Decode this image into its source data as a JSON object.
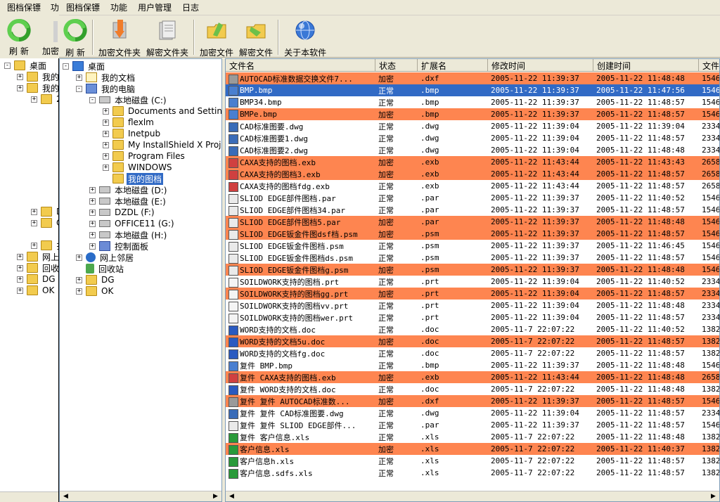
{
  "back_window": {
    "menu": [
      "图档保镖",
      "功"
    ],
    "toolbar": [
      "刷 新",
      "加密"
    ]
  },
  "menu": [
    "图档保镖",
    "功能",
    "用户管理",
    "日志"
  ],
  "toolbar": [
    {
      "label": "刷 新",
      "icon": "refresh-icon"
    },
    {
      "label": "加密文件夹",
      "icon": "encrypt-folder-icon"
    },
    {
      "label": "解密文件夹",
      "icon": "decrypt-folder-icon"
    },
    {
      "label": "加密文件",
      "icon": "encrypt-file-icon"
    },
    {
      "label": "解密文件",
      "icon": "decrypt-file-icon"
    },
    {
      "label": "关于本软件",
      "icon": "about-icon"
    }
  ],
  "back_tree": [
    {
      "label": "桌面"
    },
    {
      "label": "我的"
    },
    {
      "label": "我的"
    },
    {
      "label": "2"
    },
    {
      "label": "D"
    },
    {
      "label": "O"
    },
    {
      "label": "扌"
    },
    {
      "label": "网上"
    },
    {
      "label": "回收"
    },
    {
      "label": "DG"
    },
    {
      "label": "OK"
    }
  ],
  "tree": [
    {
      "label": "桌面",
      "icon": "desk",
      "level": 0,
      "exp": "-"
    },
    {
      "label": "我的文档",
      "icon": "docs",
      "level": 1,
      "exp": "+"
    },
    {
      "label": "我的电脑",
      "icon": "comp",
      "level": 1,
      "exp": "-"
    },
    {
      "label": "本地磁盘 (C:)",
      "icon": "drive",
      "level": 2,
      "exp": "-"
    },
    {
      "label": "Documents and Settings",
      "icon": "folder",
      "level": 3,
      "exp": "+"
    },
    {
      "label": "flexlm",
      "icon": "folder",
      "level": 3,
      "exp": "+"
    },
    {
      "label": "Inetpub",
      "icon": "folder",
      "level": 3,
      "exp": "+"
    },
    {
      "label": "My InstallShield X Projects",
      "icon": "folder",
      "level": 3,
      "exp": "+"
    },
    {
      "label": "Program Files",
      "icon": "folder",
      "level": 3,
      "exp": "+"
    },
    {
      "label": "WINDOWS",
      "icon": "folder",
      "level": 3,
      "exp": "+"
    },
    {
      "label": "我的图档",
      "icon": "folder",
      "level": 3,
      "exp": "",
      "selected": true
    },
    {
      "label": "本地磁盘 (D:)",
      "icon": "drive",
      "level": 2,
      "exp": "+"
    },
    {
      "label": "本地磁盘 (E:)",
      "icon": "drive",
      "level": 2,
      "exp": "+"
    },
    {
      "label": "DZDL (F:)",
      "icon": "drive",
      "level": 2,
      "exp": "+"
    },
    {
      "label": "OFFICE11 (G:)",
      "icon": "drive",
      "level": 2,
      "exp": "+"
    },
    {
      "label": "本地磁盘 (H:)",
      "icon": "drive",
      "level": 2,
      "exp": "+"
    },
    {
      "label": "控制面板",
      "icon": "panel",
      "level": 2,
      "exp": "+"
    },
    {
      "label": "网上邻居",
      "icon": "net",
      "level": 1,
      "exp": "+"
    },
    {
      "label": "回收站",
      "icon": "recycle",
      "level": 1,
      "exp": ""
    },
    {
      "label": "DG",
      "icon": "folder",
      "level": 1,
      "exp": "+"
    },
    {
      "label": "OK",
      "icon": "folder",
      "level": 1,
      "exp": "+"
    }
  ],
  "columns": [
    "文件名",
    "状态",
    "扩展名",
    "修改时间",
    "创建时间",
    "文件"
  ],
  "files": [
    {
      "name": "AUTOCAD标准数据交换文件7...",
      "status": "加密",
      "ext": ".dxf",
      "mtime": "2005-11-22 11:39:37",
      "ctime": "2005-11-22 11:48:48",
      "size": "1546",
      "state": "enc"
    },
    {
      "name": "BMP.bmp",
      "status": "正常",
      "ext": ".bmp",
      "mtime": "2005-11-22 11:39:37",
      "ctime": "2005-11-22 11:47:56",
      "size": "1546",
      "state": "sel"
    },
    {
      "name": "BMP34.bmp",
      "status": "正常",
      "ext": ".bmp",
      "mtime": "2005-11-22 11:39:37",
      "ctime": "2005-11-22 11:48:57",
      "size": "1546",
      "state": ""
    },
    {
      "name": "BMPe.bmp",
      "status": "加密",
      "ext": ".bmp",
      "mtime": "2005-11-22 11:39:37",
      "ctime": "2005-11-22 11:48:57",
      "size": "1546",
      "state": "enc"
    },
    {
      "name": "CAD标准图要.dwg",
      "status": "正常",
      "ext": ".dwg",
      "mtime": "2005-11-22 11:39:04",
      "ctime": "2005-11-22 11:39:04",
      "size": "2334",
      "state": ""
    },
    {
      "name": "CAD标准图要1.dwg",
      "status": "正常",
      "ext": ".dwg",
      "mtime": "2005-11-22 11:39:04",
      "ctime": "2005-11-22 11:48:57",
      "size": "2334",
      "state": ""
    },
    {
      "name": "CAD标准图要2.dwg",
      "status": "正常",
      "ext": ".dwg",
      "mtime": "2005-11-22 11:39:04",
      "ctime": "2005-11-22 11:48:48",
      "size": "2334",
      "state": ""
    },
    {
      "name": "CAXA支持的图档.exb",
      "status": "加密",
      "ext": ".exb",
      "mtime": "2005-11-22 11:43:44",
      "ctime": "2005-11-22 11:43:43",
      "size": "2658",
      "state": "enc"
    },
    {
      "name": "CAXA支持的图档3.exb",
      "status": "加密",
      "ext": ".exb",
      "mtime": "2005-11-22 11:43:44",
      "ctime": "2005-11-22 11:48:57",
      "size": "2658",
      "state": "enc"
    },
    {
      "name": "CAXA支持的图档fdg.exb",
      "status": "正常",
      "ext": ".exb",
      "mtime": "2005-11-22 11:43:44",
      "ctime": "2005-11-22 11:48:57",
      "size": "2658",
      "state": ""
    },
    {
      "name": "SLIOD EDGE部件图档.par",
      "status": "正常",
      "ext": ".par",
      "mtime": "2005-11-22 11:39:37",
      "ctime": "2005-11-22 11:40:52",
      "size": "1546",
      "state": ""
    },
    {
      "name": "SLIOD EDGE部件图档34.par",
      "status": "正常",
      "ext": ".par",
      "mtime": "2005-11-22 11:39:37",
      "ctime": "2005-11-22 11:48:57",
      "size": "1546",
      "state": ""
    },
    {
      "name": "SLIOD EDGE部件图档5.par",
      "status": "加密",
      "ext": ".par",
      "mtime": "2005-11-22 11:39:37",
      "ctime": "2005-11-22 11:48:48",
      "size": "1546",
      "state": "enc"
    },
    {
      "name": "SLIOD EDGE钣金件图dsf档.psm",
      "status": "加密",
      "ext": ".psm",
      "mtime": "2005-11-22 11:39:37",
      "ctime": "2005-11-22 11:48:57",
      "size": "1546",
      "state": "enc"
    },
    {
      "name": "SLIOD EDGE钣金件图档.psm",
      "status": "正常",
      "ext": ".psm",
      "mtime": "2005-11-22 11:39:37",
      "ctime": "2005-11-22 11:46:45",
      "size": "1546",
      "state": ""
    },
    {
      "name": "SLIOD EDGE钣金件图档ds.psm",
      "status": "正常",
      "ext": ".psm",
      "mtime": "2005-11-22 11:39:37",
      "ctime": "2005-11-22 11:48:57",
      "size": "1546",
      "state": ""
    },
    {
      "name": "SLIOD EDGE钣金件图档g.psm",
      "status": "加密",
      "ext": ".psm",
      "mtime": "2005-11-22 11:39:37",
      "ctime": "2005-11-22 11:48:48",
      "size": "1546",
      "state": "enc"
    },
    {
      "name": "SOILDWORK支持的图档.prt",
      "status": "正常",
      "ext": ".prt",
      "mtime": "2005-11-22 11:39:04",
      "ctime": "2005-11-22 11:40:52",
      "size": "2334",
      "state": ""
    },
    {
      "name": "SOILDWORK支持的图档gg.prt",
      "status": "加密",
      "ext": ".prt",
      "mtime": "2005-11-22 11:39:04",
      "ctime": "2005-11-22 11:48:57",
      "size": "2334",
      "state": "enc"
    },
    {
      "name": "SOILDWORK支持的图档vv.prt",
      "status": "正常",
      "ext": ".prt",
      "mtime": "2005-11-22 11:39:04",
      "ctime": "2005-11-22 11:48:48",
      "size": "2334",
      "state": ""
    },
    {
      "name": "SOILDWORK支持的图档wer.prt",
      "status": "正常",
      "ext": ".prt",
      "mtime": "2005-11-22 11:39:04",
      "ctime": "2005-11-22 11:48:57",
      "size": "2334",
      "state": ""
    },
    {
      "name": "WORD支持的文档.doc",
      "status": "正常",
      "ext": ".doc",
      "mtime": "2005-11-7 22:07:22",
      "ctime": "2005-11-22 11:40:52",
      "size": "1382",
      "state": ""
    },
    {
      "name": "WORD支持的文档5u.doc",
      "status": "加密",
      "ext": ".doc",
      "mtime": "2005-11-7 22:07:22",
      "ctime": "2005-11-22 11:48:57",
      "size": "1382",
      "state": "enc"
    },
    {
      "name": "WORD支持的文档fg.doc",
      "status": "正常",
      "ext": ".doc",
      "mtime": "2005-11-7 22:07:22",
      "ctime": "2005-11-22 11:48:57",
      "size": "1382",
      "state": ""
    },
    {
      "name": "复件 BMP.bmp",
      "status": "正常",
      "ext": ".bmp",
      "mtime": "2005-11-22 11:39:37",
      "ctime": "2005-11-22 11:48:48",
      "size": "1546",
      "state": ""
    },
    {
      "name": "复件 CAXA支持的图档.exb",
      "status": "加密",
      "ext": ".exb",
      "mtime": "2005-11-22 11:43:44",
      "ctime": "2005-11-22 11:48:48",
      "size": "2658",
      "state": "enc"
    },
    {
      "name": "复件 WORD支持的文档.doc",
      "status": "正常",
      "ext": ".doc",
      "mtime": "2005-11-7 22:07:22",
      "ctime": "2005-11-22 11:48:48",
      "size": "1382",
      "state": ""
    },
    {
      "name": "复件 复件 AUTOCAD标准数...",
      "status": "加密",
      "ext": ".dxf",
      "mtime": "2005-11-22 11:39:37",
      "ctime": "2005-11-22 11:48:57",
      "size": "1546",
      "state": "enc"
    },
    {
      "name": "复件 复件 CAD标准图要.dwg",
      "status": "正常",
      "ext": ".dwg",
      "mtime": "2005-11-22 11:39:04",
      "ctime": "2005-11-22 11:48:57",
      "size": "2334",
      "state": ""
    },
    {
      "name": "复件 复件 SLIOD EDGE部件...",
      "status": "正常",
      "ext": ".par",
      "mtime": "2005-11-22 11:39:37",
      "ctime": "2005-11-22 11:48:57",
      "size": "1546",
      "state": ""
    },
    {
      "name": "复件 客户信息.xls",
      "status": "正常",
      "ext": ".xls",
      "mtime": "2005-11-7 22:07:22",
      "ctime": "2005-11-22 11:48:48",
      "size": "1382",
      "state": ""
    },
    {
      "name": "客户信息.xls",
      "status": "加密",
      "ext": ".xls",
      "mtime": "2005-11-7 22:07:22",
      "ctime": "2005-11-22 11:40:37",
      "size": "1382",
      "state": "enc"
    },
    {
      "name": "客户信息h.xls",
      "status": "正常",
      "ext": ".xls",
      "mtime": "2005-11-7 22:07:22",
      "ctime": "2005-11-22 11:48:57",
      "size": "1382",
      "state": ""
    },
    {
      "name": "客户信息.sdfs.xls",
      "status": "正常",
      "ext": ".xls",
      "mtime": "2005-11-7 22:07:22",
      "ctime": "2005-11-22 11:48:57",
      "size": "1382",
      "state": ""
    }
  ],
  "colors": {
    "encrypted_row": "#fe8550",
    "selected_row": "#316ac5"
  }
}
